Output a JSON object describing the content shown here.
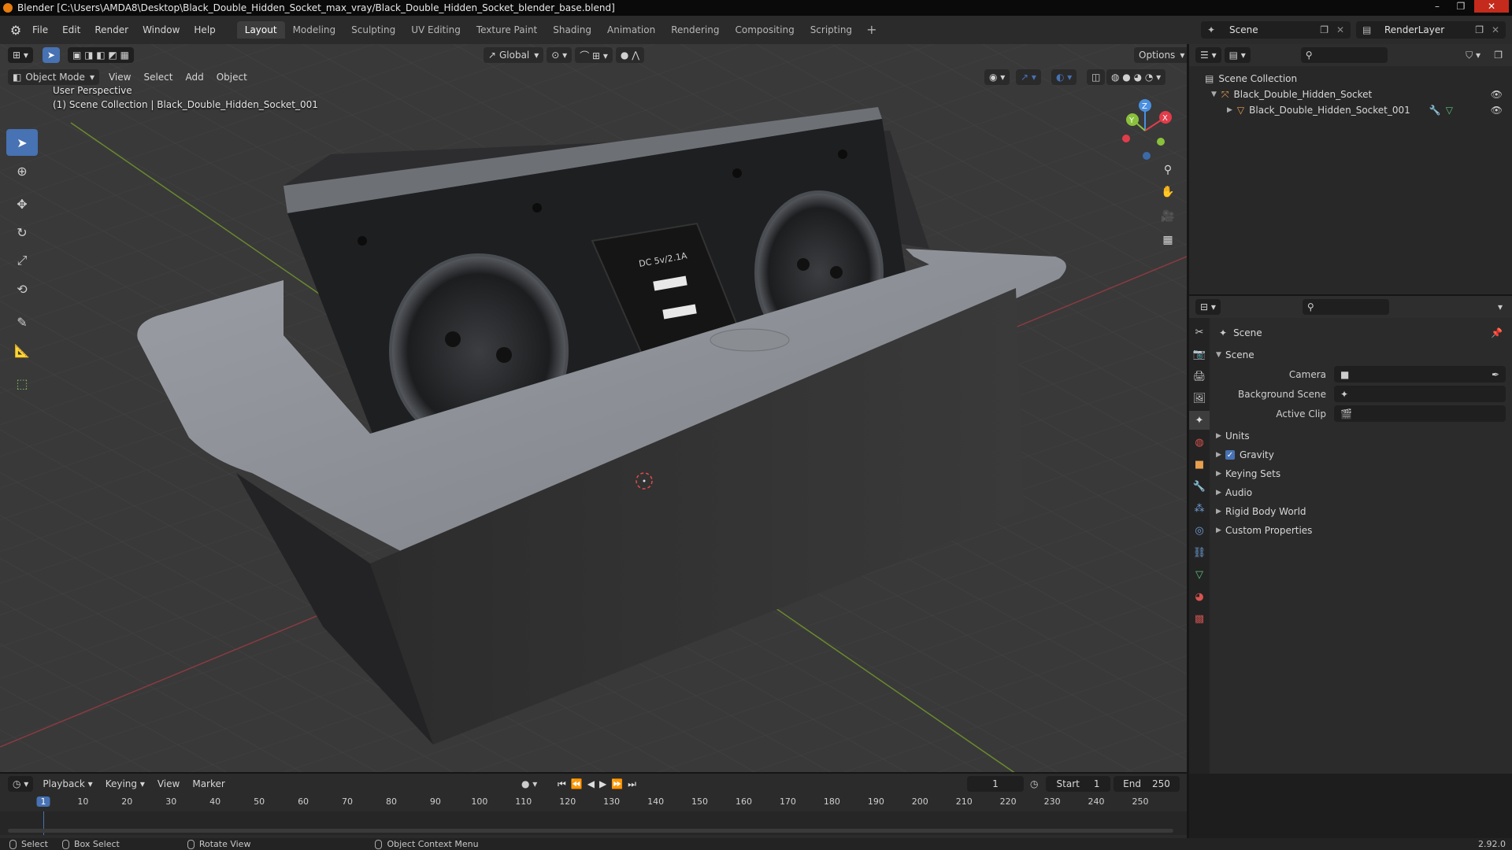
{
  "window": {
    "title": "Blender [C:\\Users\\AMDA8\\Desktop\\Black_Double_Hidden_Socket_max_vray/Black_Double_Hidden_Socket_blender_base.blend]",
    "minimize": "–",
    "maximize": "❐",
    "close": "✕"
  },
  "menu": [
    "File",
    "Edit",
    "Render",
    "Window",
    "Help"
  ],
  "workspaces": [
    "Layout",
    "Modeling",
    "Sculpting",
    "UV Editing",
    "Texture Paint",
    "Shading",
    "Animation",
    "Rendering",
    "Compositing",
    "Scripting"
  ],
  "active_workspace": "Layout",
  "scene_name": "Scene",
  "render_layer": "RenderLayer",
  "viewport": {
    "transform_orientation": "Global",
    "options_label": "Options",
    "mode": "Object Mode",
    "menus": [
      "View",
      "Select",
      "Add",
      "Object"
    ],
    "perspective_label": "User Perspective",
    "collection_label": "(1) Scene Collection | Black_Double_Hidden_Socket_001",
    "socket_print": "DC 5v/2.1A",
    "gizmo": {
      "x": "X",
      "y": "Y",
      "z": "Z"
    }
  },
  "outliner": {
    "root": "Scene Collection",
    "items": [
      {
        "name": "Black_Double_Hidden_Socket",
        "level": 1
      },
      {
        "name": "Black_Double_Hidden_Socket_001",
        "level": 2
      }
    ]
  },
  "properties": {
    "context": "Scene",
    "panel": "Scene",
    "fields": [
      {
        "label": "Camera",
        "value": ""
      },
      {
        "label": "Background Scene",
        "value": ""
      },
      {
        "label": "Active Clip",
        "value": ""
      }
    ],
    "subpanels": [
      "Units",
      "Gravity",
      "Keying Sets",
      "Audio",
      "Rigid Body World",
      "Custom Properties"
    ],
    "gravity_checked": true
  },
  "timeline": {
    "menus": [
      "Playback",
      "Keying",
      "View",
      "Marker"
    ],
    "current_frame": "1",
    "start_label": "Start",
    "start": "1",
    "end_label": "End",
    "end": "250",
    "ticks": [
      "1",
      "10",
      "20",
      "30",
      "40",
      "50",
      "60",
      "70",
      "80",
      "90",
      "100",
      "110",
      "120",
      "130",
      "140",
      "150",
      "160",
      "170",
      "180",
      "190",
      "200",
      "210",
      "220",
      "230",
      "240",
      "250"
    ]
  },
  "statusbar": {
    "select": "Select",
    "box_select": "Box Select",
    "rotate_view": "Rotate View",
    "context_menu": "Object Context Menu",
    "version": "2.92.0"
  },
  "colors": {
    "accent": "#4772b3",
    "x_axis": "#e23c4a",
    "y_axis": "#8ac13b",
    "z_axis": "#4a8fe0"
  }
}
